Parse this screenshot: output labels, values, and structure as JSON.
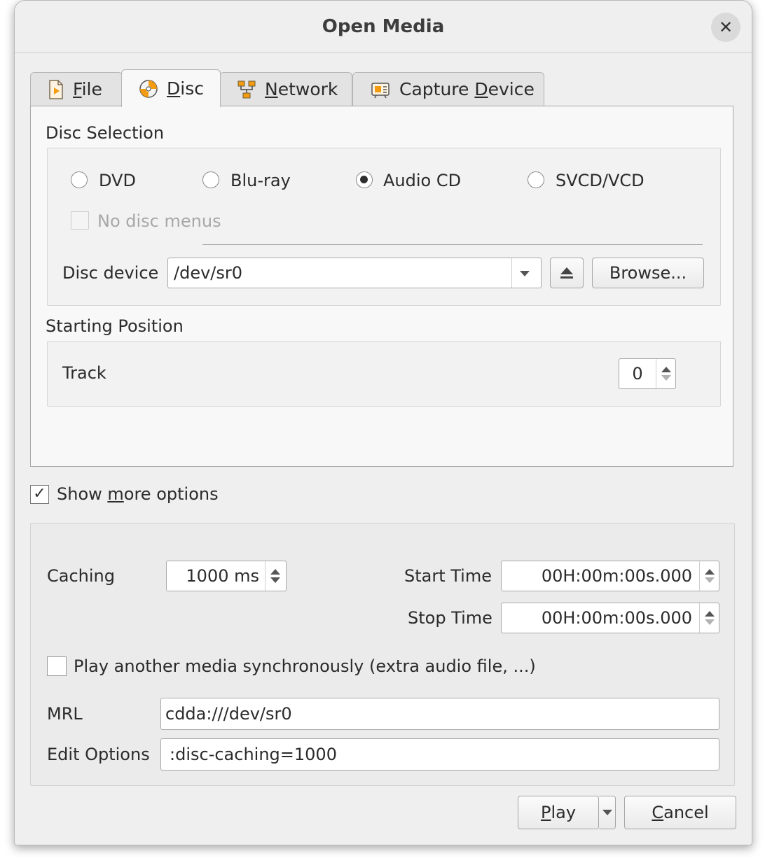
{
  "window": {
    "title": "Open Media"
  },
  "tabs": [
    {
      "pre": "",
      "ul": "F",
      "post": "ile",
      "icon": "file-icon"
    },
    {
      "pre": "",
      "ul": "D",
      "post": "isc",
      "icon": "disc-icon",
      "active": true
    },
    {
      "pre": "",
      "ul": "N",
      "post": "etwork",
      "icon": "network-icon"
    },
    {
      "pre": "Capture ",
      "ul": "D",
      "post": "evice",
      "icon": "capture-device-icon"
    }
  ],
  "disc_selection": {
    "label": "Disc Selection",
    "options": [
      "DVD",
      "Blu-ray",
      "Audio CD",
      "SVCD/VCD"
    ],
    "selected": "Audio CD",
    "no_disc_menus": "No disc menus",
    "disc_device_label": "Disc device",
    "disc_device_value": "/dev/sr0",
    "browse_label": "Browse..."
  },
  "starting_position": {
    "label": "Starting Position",
    "track_label": "Track",
    "track_value": "0"
  },
  "show_more": {
    "pre": "Show ",
    "ul": "m",
    "post": "ore options",
    "checked": true
  },
  "more_options": {
    "caching_label": "Caching",
    "caching_value": "1000 ms",
    "start_time_label": "Start Time",
    "start_time_value": "00H:00m:00s.000",
    "stop_time_label": "Stop Time",
    "stop_time_value": "00H:00m:00s.000",
    "play_another": "Play another media synchronously (extra audio file, ...)",
    "mrl_label": "MRL",
    "mrl_value": "cdda:///dev/sr0",
    "edit_options_label": "Edit Options",
    "edit_options_value": ":disc-caching=1000"
  },
  "buttons": {
    "play": {
      "ul": "P",
      "post": "lay"
    },
    "cancel": {
      "ul": "C",
      "post": "ancel"
    }
  }
}
